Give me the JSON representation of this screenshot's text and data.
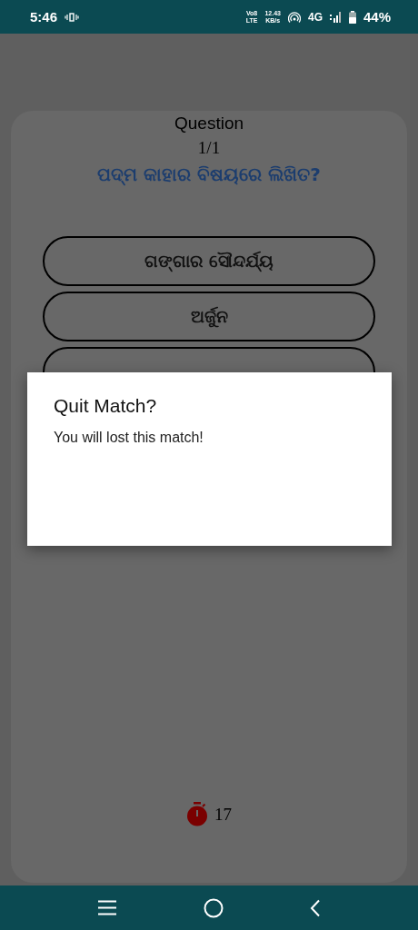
{
  "status_bar": {
    "time": "5:46",
    "volte_top": "Vo8",
    "volte_bottom": "LTE",
    "speed": "12.43",
    "speed_unit": "KB/s",
    "network": "4G",
    "battery": "44%"
  },
  "quiz": {
    "heading": "Question",
    "counter": "1/1",
    "question": "ପଦ୍ମ କାହାର ବିଷୟରେ ଲିଖିତ?",
    "options": [
      {
        "kind": "answer",
        "label": "ଗଙ୍ଗାର ସୌନ୍ଦର୍ଯ୍ୟ"
      },
      {
        "kind": "answer",
        "label": "ଅର୍ଜୁନ"
      },
      {
        "kind": "covered"
      }
    ],
    "timer": "17"
  },
  "dialog": {
    "title": "Quit Match?",
    "message": "You will lost this match!"
  }
}
